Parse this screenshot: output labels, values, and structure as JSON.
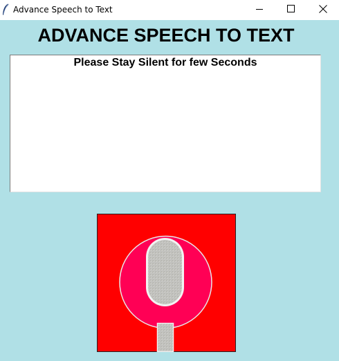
{
  "window": {
    "title": "Advance Speech to Text",
    "controls": {
      "minimize_icon": "minimize-icon",
      "maximize_icon": "maximize-icon",
      "close_icon": "close-icon"
    }
  },
  "app": {
    "heading": "ADVANCE SPEECH TO TEXT",
    "transcript_status": "Please Stay Silent for few Seconds",
    "mic_button_icon": "microphone-icon"
  },
  "colors": {
    "background": "#b0e0e6",
    "mic_button_bg": "#ff0000",
    "mic_circle": "#ff0055",
    "mic_capsule": "#c0c0c0"
  }
}
